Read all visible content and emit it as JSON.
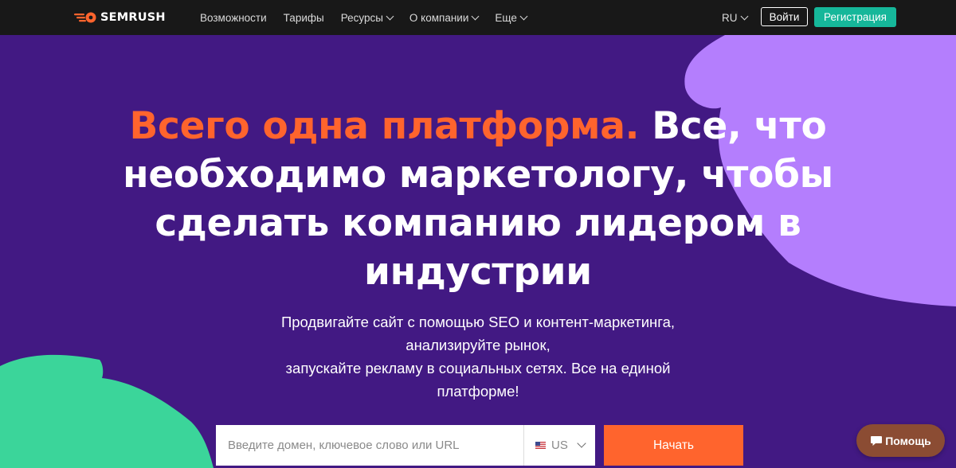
{
  "colors": {
    "page_background": "#421983",
    "topbar_background": "#181818",
    "accent_orange": "#ff642d",
    "register_green": "#16b79a",
    "decor_purple": "#b47efd",
    "decor_green": "#3bd59a",
    "help_button": "#8b4c33"
  },
  "header": {
    "logo_icon": "semrush-flame-icon",
    "logo_text": "SEMRUSH",
    "nav": [
      {
        "label": "Возможности",
        "has_dropdown": false
      },
      {
        "label": "Тарифы",
        "has_dropdown": false
      },
      {
        "label": "Ресурсы",
        "has_dropdown": true
      },
      {
        "label": "О компании",
        "has_dropdown": true
      },
      {
        "label": "Еще",
        "has_dropdown": true
      }
    ],
    "language": "RU",
    "login_label": "Войти",
    "register_label": "Регистрация"
  },
  "hero": {
    "headline_accent": "Всего одна платформа.",
    "headline_rest": "Все, что необходимо маркетологу, чтобы сделать компанию лидером в индустрии",
    "subtitle_lines": [
      "Продвигайте сайт с помощью SEO и контент-маркетинга,",
      "анализируйте рынок,",
      "запускайте рекламу в социальных сетях. Все на единой",
      "платформе!"
    ]
  },
  "search": {
    "placeholder": "Введите домен, ключевое слово или URL",
    "value": "",
    "database_flag_icon": "us-flag-icon",
    "database": "US",
    "submit_label": "Начать"
  },
  "help": {
    "icon": "chat-bubble-icon",
    "label": "Помощь"
  }
}
